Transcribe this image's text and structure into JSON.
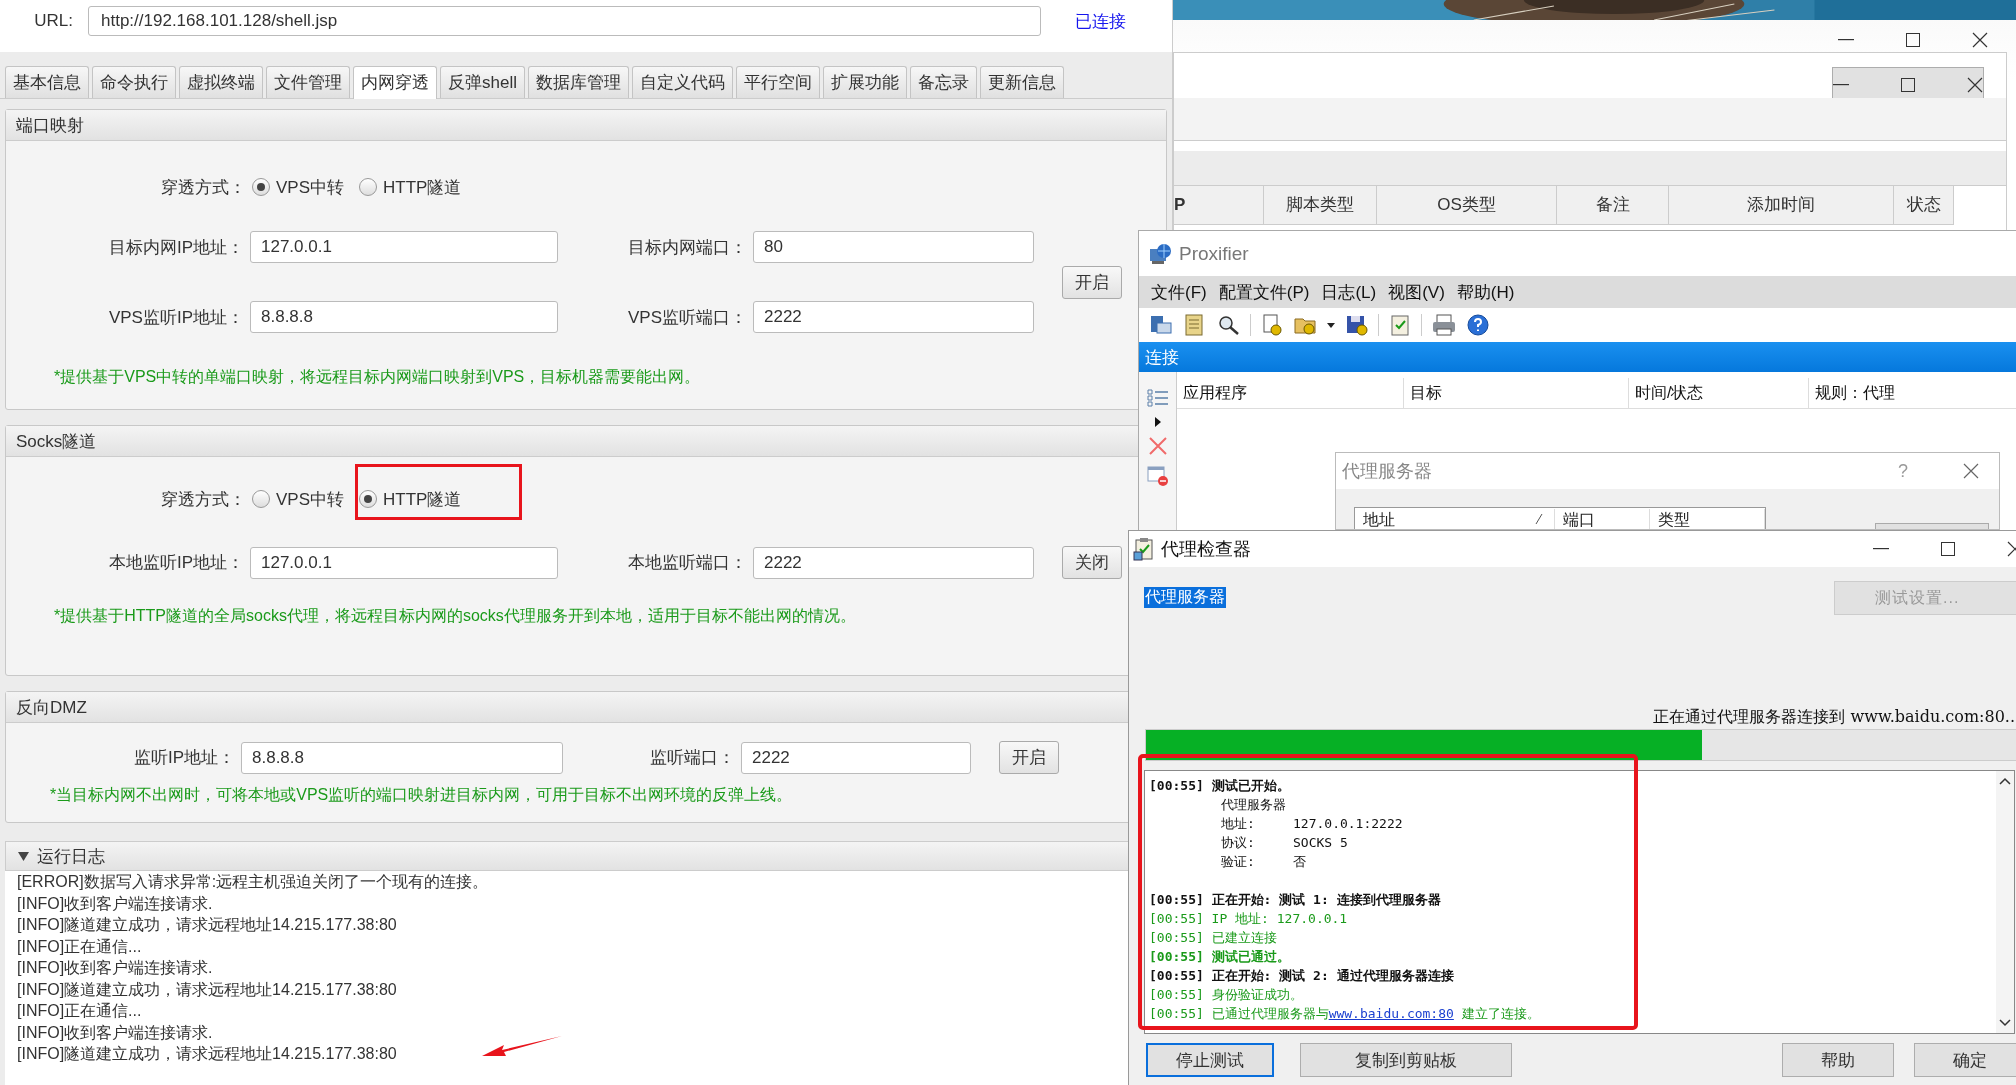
{
  "shell_window": {
    "url_label": "URL:",
    "url": "http://192.168.101.128/shell.jsp",
    "status": "已连接",
    "tabs": [
      {
        "label": "基本信息",
        "selected": false
      },
      {
        "label": "命令执行",
        "selected": false
      },
      {
        "label": "虚拟终端",
        "selected": false
      },
      {
        "label": "文件管理",
        "selected": false
      },
      {
        "label": "内网穿透",
        "selected": true
      },
      {
        "label": "反弹shell",
        "selected": false
      },
      {
        "label": "数据库管理",
        "selected": false
      },
      {
        "label": "自定义代码",
        "selected": false
      },
      {
        "label": "平行空间",
        "selected": false
      },
      {
        "label": "扩展功能",
        "selected": false
      },
      {
        "label": "备忘录",
        "selected": false
      },
      {
        "label": "更新信息",
        "selected": false
      }
    ],
    "port_mapping": {
      "title": "端口映射",
      "mode_label": "穿透方式：",
      "modes": [
        {
          "label": "VPS中转",
          "selected": true
        },
        {
          "label": "HTTP隧道",
          "selected": false
        }
      ],
      "fields": [
        {
          "label": "目标内网IP地址：",
          "value": "127.0.0.1"
        },
        {
          "label": "目标内网端口：",
          "value": "80"
        },
        {
          "label": "VPS监听IP地址：",
          "value": "8.8.8.8"
        },
        {
          "label": "VPS监听端口：",
          "value": "2222"
        }
      ],
      "button": "开启",
      "note": "*提供基于VPS中转的单端口映射，将远程目标内网端口映射到VPS，目标机器需要能出网。"
    },
    "socks_tunnel": {
      "title": "Socks隧道",
      "mode_label": "穿透方式：",
      "modes": [
        {
          "label": "VPS中转",
          "selected": false
        },
        {
          "label": "HTTP隧道",
          "selected": true
        }
      ],
      "fields": [
        {
          "label": "本地监听IP地址：",
          "value": "127.0.0.1"
        },
        {
          "label": "本地监听端口：",
          "value": "2222"
        }
      ],
      "button": "关闭",
      "note": "*提供基于HTTP隧道的全局socks代理，将远程目标内网的socks代理服务开到本地，适用于目标不能出网的情况。"
    },
    "reverse_dmz": {
      "title": "反向DMZ",
      "fields": [
        {
          "label": "监听IP地址：",
          "value": "8.8.8.8"
        },
        {
          "label": "监听端口：",
          "value": "2222"
        }
      ],
      "button": "开启",
      "note": "*当目标内网不出网时，可将本地或VPS监听的端口映射进目标内网，可用于目标不出网环境的反弹上线。"
    },
    "run_log": {
      "title": "运行日志",
      "expanded": true,
      "lines": [
        "[ERROR]数据写入请求异常:远程主机强迫关闭了一个现有的连接。",
        "[INFO]收到客户端连接请求.",
        "[INFO]隧道建立成功，请求远程地址14.215.177.38:80",
        "[INFO]正在通信...",
        "[INFO]收到客户端连接请求.",
        "[INFO]隧道建立成功，请求远程地址14.215.177.38:80",
        "[INFO]正在通信...",
        "[INFO]收到客户端连接请求.",
        "[INFO]隧道建立成功，请求远程地址14.215.177.38:80"
      ]
    }
  },
  "background_window": {
    "columns": [
      "P",
      "脚本类型",
      "OS类型",
      "备注",
      "添加时间",
      "状态"
    ]
  },
  "proxifier": {
    "title": "Proxifier",
    "menu": [
      "文件(F)",
      "配置文件(P)",
      "日志(L)",
      "视图(V)",
      "帮助(H)"
    ],
    "panel_title": "连接",
    "columns": [
      "应用程序",
      "目标",
      "时间/状态",
      "规则：代理"
    ]
  },
  "proxy_dialog": {
    "title": "代理服务器",
    "help": "?",
    "columns": [
      "地址",
      "端口",
      "类型"
    ]
  },
  "proxy_checker": {
    "title": "代理检查器",
    "section_label": "代理服务器",
    "settings_button": {
      "label": "测试设置...",
      "disabled": true
    },
    "status": "正在通过代理服务器连接到 www.baidu.com:80..",
    "progress": {
      "level": 0.63
    },
    "log": [
      {
        "kind": "heading",
        "time": "[00:55]",
        "text": "测试已开始。"
      },
      {
        "kind": "detail",
        "text": "代理服务器"
      },
      {
        "kind": "field",
        "label": "地址:",
        "value": "127.0.0.1:2222"
      },
      {
        "kind": "field",
        "label": "协议:",
        "value": "SOCKS 5"
      },
      {
        "kind": "field",
        "label": "验证:",
        "value": "否"
      },
      {
        "kind": "blank"
      },
      {
        "kind": "heading",
        "time": "[00:55]",
        "text": "正在开始: 测试 1: 连接到代理服务器"
      },
      {
        "kind": "success",
        "time": "[00:55]",
        "text": "IP 地址: 127.0.0.1"
      },
      {
        "kind": "success",
        "time": "[00:55]",
        "text": "已建立连接"
      },
      {
        "kind": "passed",
        "time": "[00:55]",
        "text": "测试已通过。"
      },
      {
        "kind": "heading",
        "time": "[00:55]",
        "text": "正在开始: 测试 2: 通过代理服务器连接"
      },
      {
        "kind": "success",
        "time": "[00:55]",
        "text": "身份验证成功。"
      },
      {
        "kind": "success",
        "time": "[00:55]",
        "text": "已通过代理服务器与",
        "link": "www.baidu.com:80",
        "after": "建立了连接。"
      }
    ],
    "buttons": [
      {
        "label": "停止测试",
        "focused": true
      },
      {
        "label": "复制到剪贴板",
        "focused": false
      },
      {
        "label": "帮助",
        "focused": false
      },
      {
        "label": "确定",
        "focused": false
      }
    ]
  }
}
